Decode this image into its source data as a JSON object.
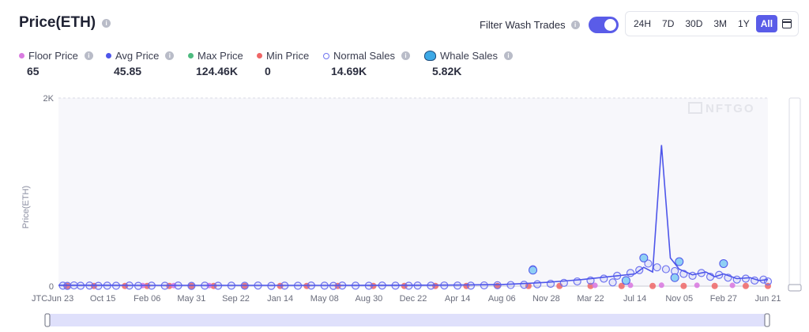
{
  "header": {
    "title": "Price(ETH)"
  },
  "filter": {
    "label": "Filter Wash Trades",
    "enabled": true
  },
  "ranges": {
    "items": [
      "24H",
      "7D",
      "30D",
      "3M",
      "1Y",
      "All"
    ],
    "active": "All"
  },
  "stats": [
    {
      "label": "Floor Price",
      "value": "65",
      "color": "#d97be0",
      "marker": "dot"
    },
    {
      "label": "Avg Price",
      "value": "45.85",
      "color": "#4e56ea",
      "marker": "dot"
    },
    {
      "label": "Max Price",
      "value": "124.46K",
      "color": "#4dbb7f",
      "marker": "dot"
    },
    {
      "label": "Min Price",
      "value": "0",
      "color": "#ef6666",
      "marker": "dot"
    },
    {
      "label": "Normal Sales",
      "value": "14.69K",
      "color": "#6f74f0",
      "marker": "ring"
    },
    {
      "label": "Whale Sales",
      "value": "5.82K",
      "color": "#3da9e6",
      "marker": "whale"
    }
  ],
  "chart_data": {
    "type": "scatter",
    "ylabel": "Price(ETH)",
    "ylim": [
      0,
      2000
    ],
    "y_ticks": [
      "0",
      "2K"
    ],
    "x_ticks": [
      "JTCJun 23",
      "Oct 15",
      "Feb 06",
      "May 31",
      "Sep 22",
      "Jan 14",
      "May 08",
      "Aug 30",
      "Dec 22",
      "Apr 14",
      "Aug 06",
      "Nov 28",
      "Mar 22",
      "Jul 14",
      "Nov 05",
      "Feb 27",
      "Jun 21"
    ],
    "watermark": "NFTGO",
    "avg_price_line": [
      [
        0,
        10
      ],
      [
        1,
        10
      ],
      [
        2,
        8
      ],
      [
        3,
        8
      ],
      [
        4,
        8
      ],
      [
        5,
        8
      ],
      [
        6,
        8
      ],
      [
        7,
        9
      ],
      [
        8,
        10
      ],
      [
        9,
        12
      ],
      [
        10,
        18
      ],
      [
        10.6,
        30
      ],
      [
        11,
        40
      ],
      [
        11.4,
        55
      ],
      [
        11.8,
        70
      ],
      [
        12.2,
        90
      ],
      [
        12.6,
        110
      ],
      [
        13,
        130
      ],
      [
        13.2,
        200
      ],
      [
        13.4,
        150
      ],
      [
        13.6,
        1500
      ],
      [
        13.8,
        300
      ],
      [
        14,
        180
      ],
      [
        14.3,
        120
      ],
      [
        14.6,
        150
      ],
      [
        14.8,
        100
      ],
      [
        15,
        130
      ],
      [
        15.3,
        80
      ],
      [
        15.6,
        90
      ],
      [
        15.8,
        60
      ],
      [
        16,
        70
      ]
    ],
    "normal_sales": [
      [
        0.1,
        5
      ],
      [
        0.2,
        3
      ],
      [
        0.35,
        8
      ],
      [
        0.5,
        4
      ],
      [
        0.7,
        6
      ],
      [
        0.9,
        3
      ],
      [
        1.1,
        5
      ],
      [
        1.3,
        4
      ],
      [
        1.6,
        6
      ],
      [
        1.8,
        3
      ],
      [
        2.1,
        5
      ],
      [
        2.4,
        4
      ],
      [
        2.7,
        6
      ],
      [
        3.0,
        3
      ],
      [
        3.3,
        5
      ],
      [
        3.6,
        4
      ],
      [
        3.9,
        5
      ],
      [
        4.2,
        4
      ],
      [
        4.5,
        6
      ],
      [
        4.8,
        3
      ],
      [
        5.1,
        5
      ],
      [
        5.4,
        4
      ],
      [
        5.7,
        6
      ],
      [
        6.0,
        5
      ],
      [
        6.2,
        3
      ],
      [
        6.4,
        6
      ],
      [
        6.7,
        5
      ],
      [
        7.0,
        4
      ],
      [
        7.3,
        6
      ],
      [
        7.6,
        5
      ],
      [
        7.9,
        4
      ],
      [
        8.1,
        6
      ],
      [
        8.4,
        5
      ],
      [
        8.7,
        7
      ],
      [
        9.0,
        6
      ],
      [
        9.3,
        5
      ],
      [
        9.6,
        8
      ],
      [
        9.9,
        10
      ],
      [
        10.2,
        12
      ],
      [
        10.5,
        15
      ],
      [
        10.8,
        20
      ],
      [
        11.1,
        25
      ],
      [
        11.4,
        35
      ],
      [
        11.7,
        50
      ],
      [
        12.0,
        60
      ],
      [
        12.3,
        80
      ],
      [
        12.6,
        110
      ],
      [
        12.9,
        140
      ],
      [
        13.1,
        170
      ],
      [
        13.3,
        240
      ],
      [
        13.5,
        200
      ],
      [
        13.7,
        180
      ],
      [
        13.9,
        160
      ],
      [
        14.1,
        130
      ],
      [
        14.3,
        110
      ],
      [
        14.5,
        140
      ],
      [
        14.7,
        100
      ],
      [
        14.9,
        120
      ],
      [
        15.1,
        90
      ],
      [
        15.3,
        70
      ],
      [
        15.5,
        80
      ],
      [
        15.7,
        60
      ],
      [
        15.9,
        70
      ],
      [
        16.0,
        50
      ],
      [
        13.2,
        300
      ],
      [
        14.0,
        260
      ],
      [
        15.0,
        240
      ],
      [
        10.7,
        180
      ],
      [
        12.5,
        40
      ]
    ],
    "whale_sales": [
      [
        10.7,
        170
      ],
      [
        13.2,
        300
      ],
      [
        14.0,
        260
      ],
      [
        15.0,
        240
      ],
      [
        12.8,
        60
      ],
      [
        13.9,
        90
      ]
    ],
    "min_price": [
      [
        0.2,
        2
      ],
      [
        0.8,
        2
      ],
      [
        1.5,
        2
      ],
      [
        2.0,
        2
      ],
      [
        2.5,
        2
      ],
      [
        3.0,
        2
      ],
      [
        3.5,
        2
      ],
      [
        4.2,
        2
      ],
      [
        5.0,
        2
      ],
      [
        5.6,
        2
      ],
      [
        6.3,
        2
      ],
      [
        7.1,
        2
      ],
      [
        7.8,
        2
      ],
      [
        8.5,
        2
      ],
      [
        9.2,
        2
      ],
      [
        9.9,
        2
      ],
      [
        10.6,
        2
      ],
      [
        11.3,
        2
      ],
      [
        12.0,
        2
      ],
      [
        12.7,
        2
      ],
      [
        13.4,
        2
      ],
      [
        14.1,
        2
      ],
      [
        14.8,
        2
      ],
      [
        15.5,
        2
      ],
      [
        16.0,
        2
      ]
    ],
    "floor_price": [
      [
        1.9,
        6
      ],
      [
        2.6,
        6
      ],
      [
        3.4,
        6
      ],
      [
        12.1,
        8
      ],
      [
        12.9,
        9
      ],
      [
        13.6,
        10
      ],
      [
        14.4,
        9
      ],
      [
        15.2,
        8
      ]
    ]
  },
  "colors": {
    "accent": "#5a5ce8",
    "scrollbar": "#dfe0fb",
    "watermark": "#e3e4ea"
  },
  "icons": {
    "info": "info-icon",
    "calendar": "calendar-icon",
    "whale": "whale-icon"
  }
}
